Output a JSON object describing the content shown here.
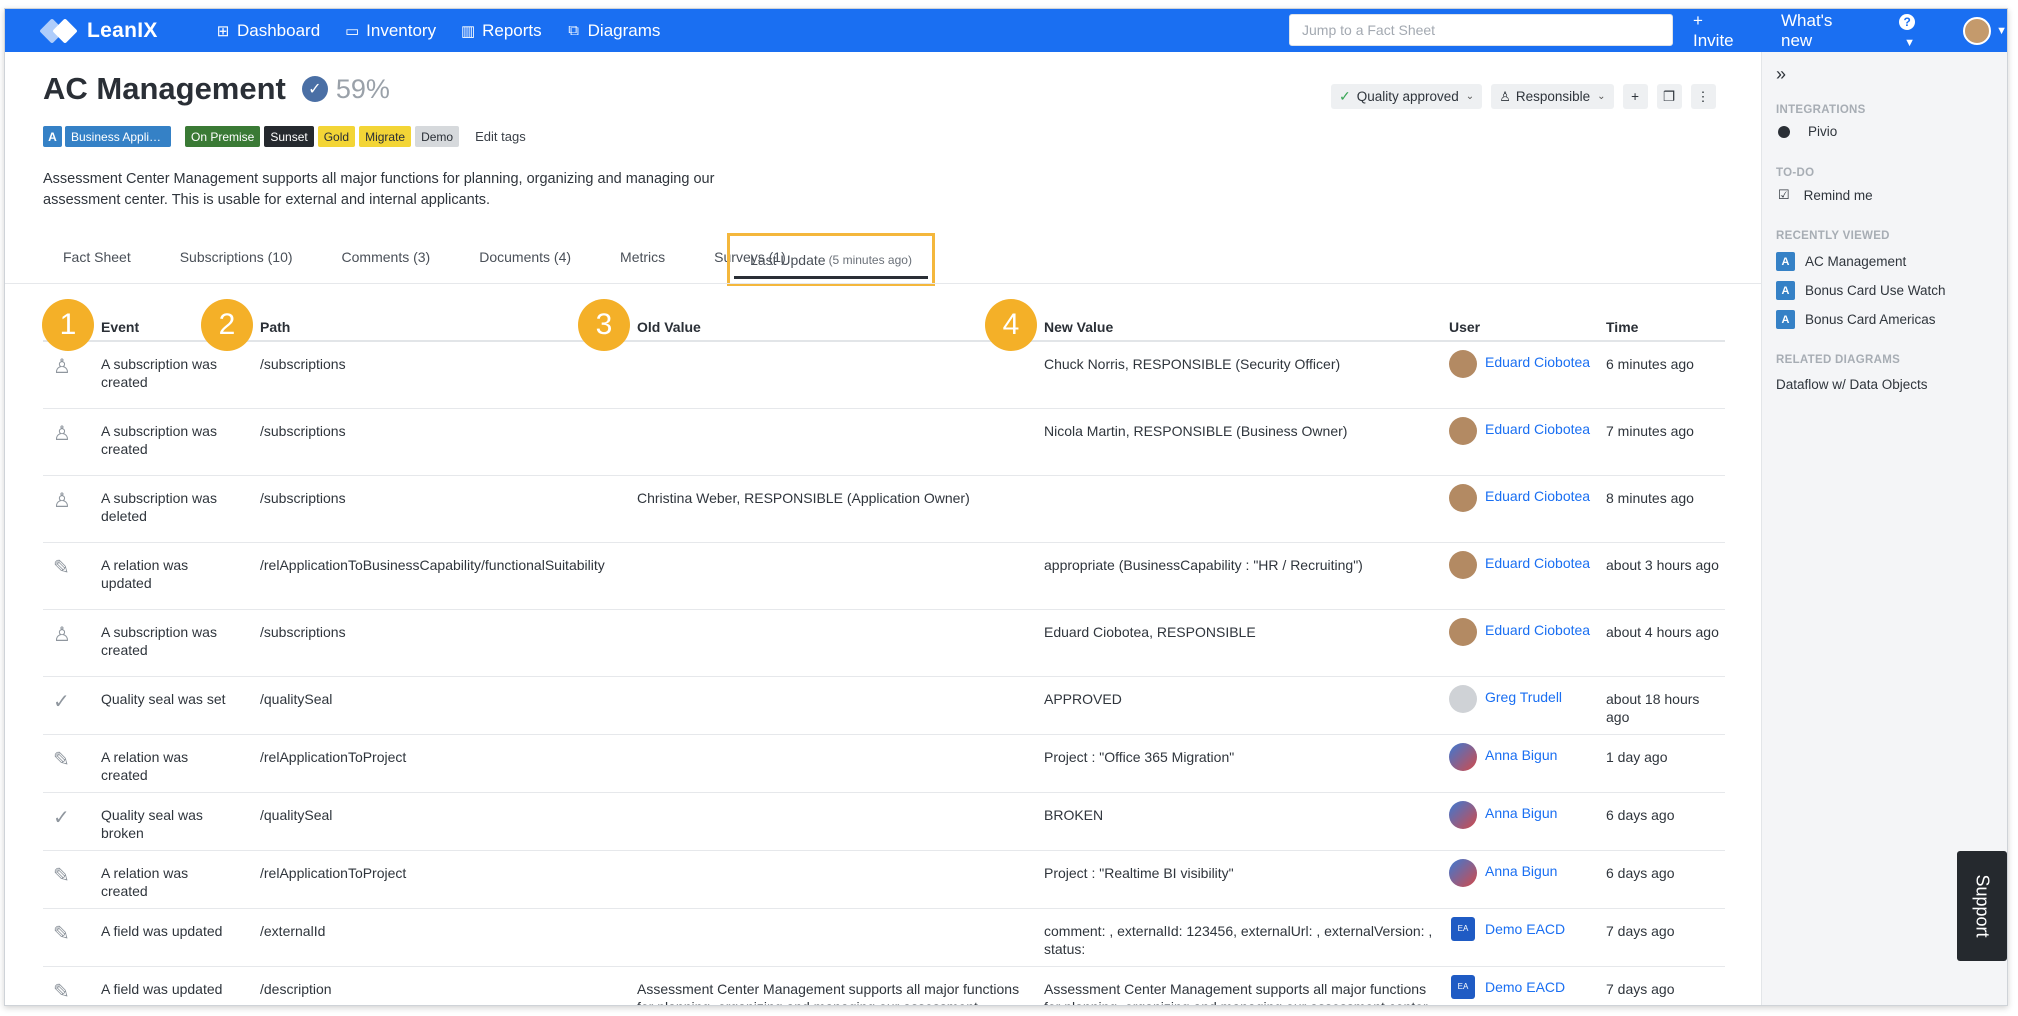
{
  "app": {
    "name": "LeanIX"
  },
  "nav": {
    "items": [
      {
        "label": "Dashboard",
        "icon": "grid-icon"
      },
      {
        "label": "Inventory",
        "icon": "inventory-icon"
      },
      {
        "label": "Reports",
        "icon": "reports-icon"
      },
      {
        "label": "Diagrams",
        "icon": "diagrams-icon"
      }
    ],
    "search_placeholder": "Jump to a Fact Sheet",
    "invite": "+ Invite",
    "whats_new": "What's new",
    "help": "?"
  },
  "factsheet": {
    "title": "AC Management",
    "completion": "59%",
    "tags": {
      "type_letter": "A",
      "type_label": "Business Appli…",
      "items": [
        {
          "label": "On Premise",
          "bg": "#3a7a35",
          "fg": "#ffffff"
        },
        {
          "label": "Sunset",
          "bg": "#25292e",
          "fg": "#ffffff"
        },
        {
          "label": "Gold",
          "bg": "#f3d536",
          "fg": "#2a2f36"
        },
        {
          "label": "Migrate",
          "bg": "#f3d536",
          "fg": "#2a2f36"
        },
        {
          "label": "Demo",
          "bg": "#d6d9dc",
          "fg": "#2a2f36"
        }
      ],
      "edit_label": "Edit tags"
    },
    "description": "Assessment Center Management supports all major functions for planning, organizing and managing our assessment center. This is usable for external and internal applicants.",
    "actions": {
      "quality": "Quality approved",
      "responsible": "Responsible"
    }
  },
  "tabs": {
    "items": [
      "Fact Sheet",
      "Subscriptions (10)",
      "Comments (3)",
      "Documents (4)",
      "Metrics",
      "Surveys (1)"
    ],
    "active_label": "Last Update",
    "active_note": "(5 minutes ago)"
  },
  "table": {
    "headers": [
      "Event",
      "Path",
      "Old Value",
      "New Value",
      "User",
      "Time"
    ],
    "markers": [
      "1",
      "2",
      "3",
      "4"
    ],
    "rows": [
      {
        "icon": "person-icon",
        "event": "A subscription was created",
        "path": "/subscriptions",
        "old": "",
        "new": "Chuck Norris, RESPONSIBLE (Security Officer)",
        "user": "Eduard Ciobotea",
        "avatar": "eduard",
        "time": "6 minutes ago"
      },
      {
        "icon": "person-icon",
        "event": "A subscription was created",
        "path": "/subscriptions",
        "old": "",
        "new": "Nicola Martin, RESPONSIBLE (Business Owner)",
        "user": "Eduard Ciobotea",
        "avatar": "eduard",
        "time": "7 minutes ago"
      },
      {
        "icon": "person-icon",
        "event": "A subscription was deleted",
        "path": "/subscriptions",
        "old": "Christina Weber, RESPONSIBLE (Application Owner)",
        "new": "",
        "user": "Eduard Ciobotea",
        "avatar": "eduard",
        "time": "8 minutes ago"
      },
      {
        "icon": "pencil-icon",
        "event": "A relation was updated",
        "path": "/relApplicationToBusinessCapability/functionalSuitability",
        "old": "",
        "new": "appropriate (BusinessCapability : \"HR / Recruiting\")",
        "user": "Eduard Ciobotea",
        "avatar": "eduard",
        "time": "about 3 hours ago"
      },
      {
        "icon": "person-icon",
        "event": "A subscription was created",
        "path": "/subscriptions",
        "old": "",
        "new": "Eduard Ciobotea, RESPONSIBLE",
        "user": "Eduard Ciobotea",
        "avatar": "eduard",
        "time": "about 4 hours ago"
      },
      {
        "icon": "check-icon",
        "event": "Quality seal was set",
        "path": "/qualitySeal",
        "old": "",
        "new": "APPROVED",
        "user": "Greg Trudell",
        "avatar": "greg",
        "time": "about 18 hours ago"
      },
      {
        "icon": "pencil-icon",
        "event": "A relation was created",
        "path": "/relApplicationToProject",
        "old": "",
        "new": "Project : \"Office 365 Migration\"",
        "user": "Anna Bigun",
        "avatar": "anna",
        "time": "1 day ago"
      },
      {
        "icon": "check-icon",
        "event": "Quality seal was broken",
        "path": "/qualitySeal",
        "old": "",
        "new": "BROKEN",
        "user": "Anna Bigun",
        "avatar": "anna",
        "time": "6 days ago"
      },
      {
        "icon": "pencil-icon",
        "event": "A relation was created",
        "path": "/relApplicationToProject",
        "old": "",
        "new": "Project : \"Realtime BI visibility\"",
        "user": "Anna Bigun",
        "avatar": "anna",
        "time": "6 days ago"
      },
      {
        "icon": "pencil-icon",
        "event": "A field was updated",
        "path": "/externalId",
        "old": "",
        "new": "comment: , externalId: 123456, externalUrl: , externalVersion: , status:",
        "user": "Demo EACD",
        "avatar": "demo",
        "time": "7 days ago"
      },
      {
        "icon": "pencil-icon",
        "event": "A field was updated",
        "path": "/description",
        "old": "Assessment Center Management supports all major functions for planning, organizing and managing our assessment",
        "new": "Assessment Center Management supports all major functions for planning, organizing and managing our assessment center",
        "user": "Demo EACD",
        "avatar": "demo",
        "time": "7 days ago"
      }
    ]
  },
  "sidebar": {
    "integrations_title": "INTEGRATIONS",
    "integration": "Pivio",
    "todo_title": "TO-DO",
    "todo": "Remind me",
    "recent_title": "RECENTLY VIEWED",
    "recent": [
      "AC Management",
      "Bonus Card Use Watch",
      "Bonus Card Americas"
    ],
    "diagrams_title": "RELATED DIAGRAMS",
    "diagram": "Dataflow w/ Data Objects"
  },
  "support_label": "Support"
}
